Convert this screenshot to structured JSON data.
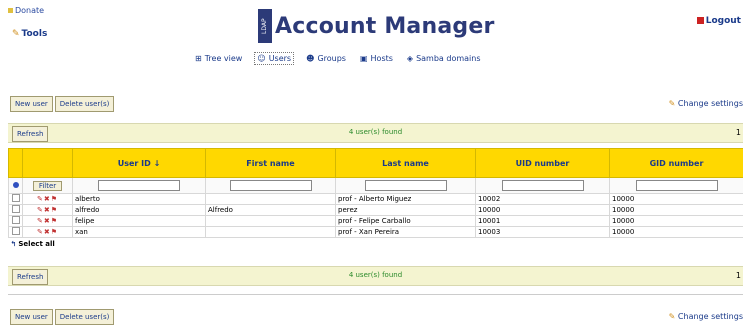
{
  "header": {
    "donate_label": "Donate",
    "tools_label": "Tools",
    "title": "Account Manager",
    "ldap_badge": "LDAP",
    "logout_label": "Logout"
  },
  "nav": {
    "items": [
      {
        "label": "Tree view",
        "icon": "tree-icon"
      },
      {
        "label": "Users",
        "icon": "user-icon",
        "active": true
      },
      {
        "label": "Groups",
        "icon": "group-icon"
      },
      {
        "label": "Hosts",
        "icon": "host-icon"
      },
      {
        "label": "Samba domains",
        "icon": "samba-icon"
      }
    ]
  },
  "toolbar": {
    "new_user": "New user",
    "delete_users": "Delete user(s)",
    "change_settings": "Change settings"
  },
  "list": {
    "refresh_label": "Refresh",
    "found_text": "4 user(s) found",
    "page_number": "1",
    "filter_label": "Filter",
    "select_all_label": "Select all",
    "columns": [
      "User ID",
      "First name",
      "Last name",
      "UID number",
      "GID number"
    ],
    "sort_indicator": "↓",
    "rows": [
      {
        "uid": "alberto",
        "first": "",
        "last": "prof - Alberto Miguez",
        "uidnum": "10002",
        "gidnum": "10000"
      },
      {
        "uid": "alfredo",
        "first": "Alfredo",
        "last": "perez",
        "uidnum": "10000",
        "gidnum": "10000"
      },
      {
        "uid": "felipe",
        "first": "",
        "last": "prof - Felipe Carballo",
        "uidnum": "10001",
        "gidnum": "10000"
      },
      {
        "uid": "xan",
        "first": "",
        "last": "prof - Xan Pereira",
        "uidnum": "10003",
        "gidnum": "10000"
      }
    ]
  },
  "colors": {
    "header_yellow": "#ffd800",
    "bar_bg": "#f4f4d0",
    "link_blue": "#1a3a8a"
  }
}
